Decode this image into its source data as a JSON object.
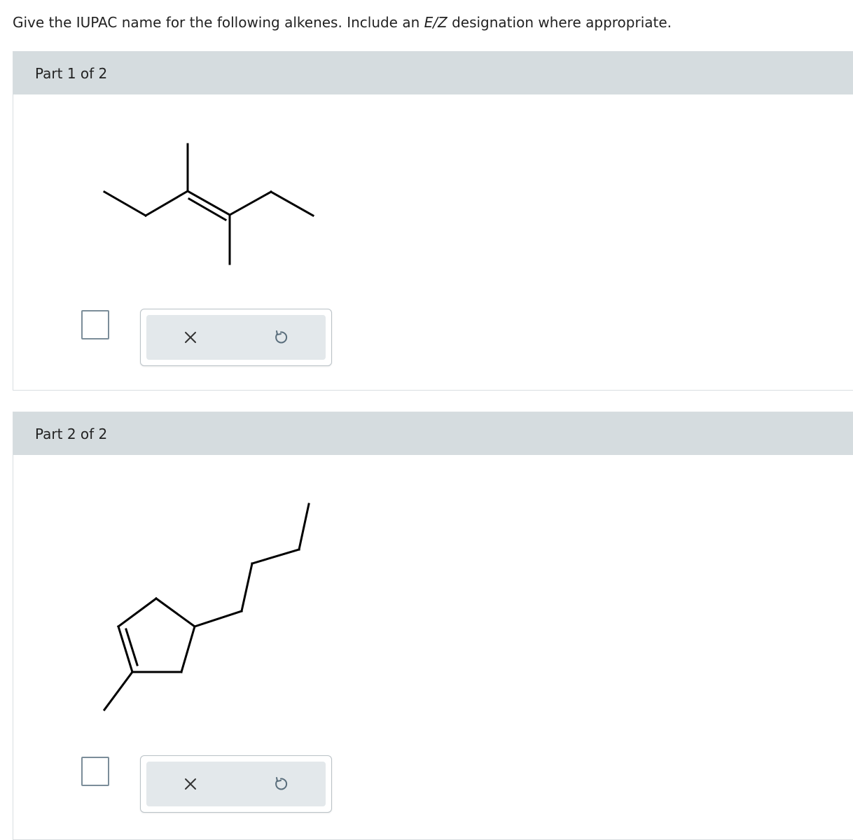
{
  "question": {
    "prefix": "Give the IUPAC name for the following alkenes. Include an ",
    "ez": "E/Z",
    "suffix": " designation where appropriate."
  },
  "parts": [
    {
      "title": "Part 1 of 2",
      "answer_value": "",
      "clear_icon": "x-icon",
      "undo_icon": "undo-icon"
    },
    {
      "title": "Part 2 of 2",
      "answer_value": "",
      "clear_icon": "x-icon",
      "undo_icon": "undo-icon"
    }
  ],
  "colors": {
    "header_bg": "#d5dcdf",
    "tool_bg": "#e3e8eb",
    "icon": "#333333",
    "undo_icon": "#5a6e7c"
  }
}
